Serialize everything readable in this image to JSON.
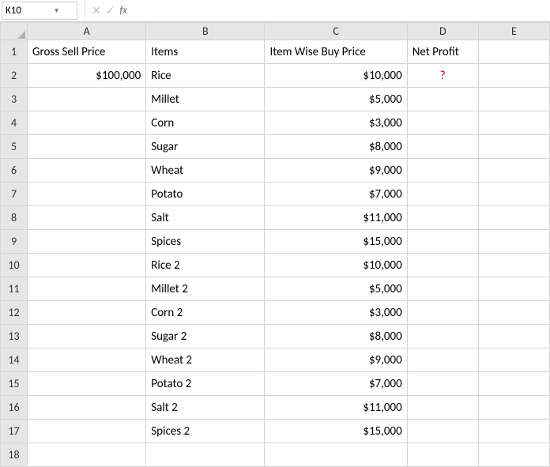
{
  "nameBox": {
    "value": "K10"
  },
  "formulaBar": {
    "value": ""
  },
  "columns": [
    "A",
    "B",
    "C",
    "D",
    "E"
  ],
  "activeCell": "K10",
  "activeRow": 10,
  "headerRow": {
    "A": "Gross Sell Price",
    "B": "Items",
    "C": "Item Wise Buy Price",
    "D": "Net Profit"
  },
  "grossSellPrice": "$100,000",
  "netProfitPlaceholder": "?",
  "rows": [
    {
      "n": 2,
      "item": "Rice",
      "price": "$10,000"
    },
    {
      "n": 3,
      "item": "Millet",
      "price": "$5,000"
    },
    {
      "n": 4,
      "item": "Corn",
      "price": "$3,000"
    },
    {
      "n": 5,
      "item": "Sugar",
      "price": "$8,000"
    },
    {
      "n": 6,
      "item": "Wheat",
      "price": "$9,000"
    },
    {
      "n": 7,
      "item": "Potato",
      "price": "$7,000"
    },
    {
      "n": 8,
      "item": "Salt",
      "price": "$11,000"
    },
    {
      "n": 9,
      "item": "Spices",
      "price": "$15,000"
    },
    {
      "n": 10,
      "item": "Rice 2",
      "price": "$10,000"
    },
    {
      "n": 11,
      "item": "Millet 2",
      "price": "$5,000"
    },
    {
      "n": 12,
      "item": "Corn 2",
      "price": "$3,000"
    },
    {
      "n": 13,
      "item": "Sugar 2",
      "price": "$8,000"
    },
    {
      "n": 14,
      "item": "Wheat 2",
      "price": "$9,000"
    },
    {
      "n": 15,
      "item": "Potato 2",
      "price": "$7,000"
    },
    {
      "n": 16,
      "item": "Salt 2",
      "price": "$11,000"
    },
    {
      "n": 17,
      "item": "Spices 2",
      "price": "$15,000"
    }
  ],
  "emptyRowNumber": "18",
  "icons": {
    "cancel": "✕",
    "enter": "✓",
    "fx": "fx",
    "caret": "▾"
  }
}
